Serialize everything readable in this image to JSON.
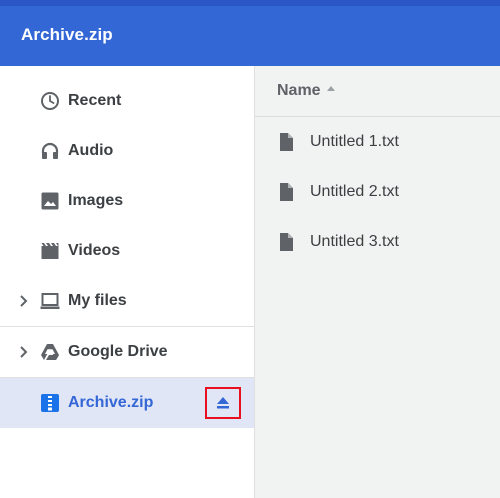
{
  "window": {
    "title": "Archive.zip"
  },
  "sidebar": {
    "items": [
      {
        "label": "Recent",
        "icon": "clock-icon"
      },
      {
        "label": "Audio",
        "icon": "headphones-icon"
      },
      {
        "label": "Images",
        "icon": "image-icon"
      },
      {
        "label": "Videos",
        "icon": "film-icon"
      },
      {
        "label": "My files",
        "icon": "laptop-icon",
        "expandable": true
      },
      {
        "label": "Google Drive",
        "icon": "google-drive-icon",
        "expandable": true
      },
      {
        "label": "Archive.zip",
        "icon": "zip-file-icon",
        "selected": true,
        "action": "eject-icon"
      }
    ]
  },
  "main": {
    "columns": [
      {
        "label": "Name",
        "sort": "ascending"
      }
    ],
    "files": [
      {
        "name": "Untitled 1.txt",
        "icon": "file-icon"
      },
      {
        "name": "Untitled 2.txt",
        "icon": "file-icon"
      },
      {
        "name": "Untitled 3.txt",
        "icon": "file-icon"
      }
    ]
  },
  "colors": {
    "title_bar": "#3367d6",
    "accent": "#3367d6",
    "selected_bg": "#e1e6f6",
    "highlight_box": "#e8101e"
  }
}
